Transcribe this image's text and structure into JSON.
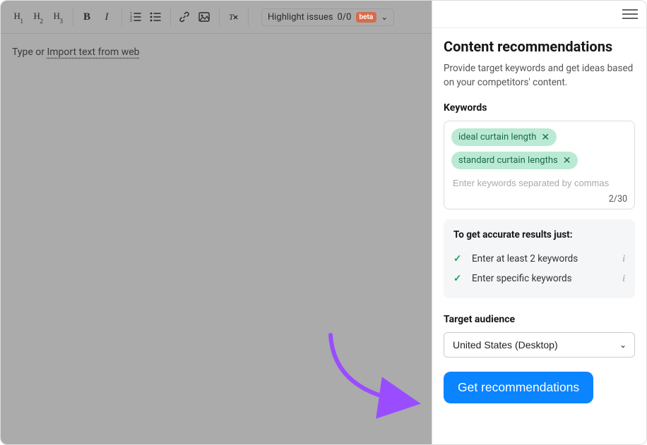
{
  "toolbar": {
    "h1": "H",
    "h1_sub": "1",
    "h2": "H",
    "h2_sub": "2",
    "h3": "H",
    "h3_sub": "3",
    "bold": "B",
    "italic": "I",
    "highlight_label": "Highlight issues",
    "highlight_count": "0/0",
    "beta_badge": "beta"
  },
  "editor": {
    "placeholder_prefix": "Type or ",
    "import_link": "Import text from web"
  },
  "sidebar": {
    "title": "Content recommendations",
    "description": "Provide target keywords and get ideas based on your competitors' content.",
    "keywords_label": "Keywords",
    "keywords": [
      "ideal curtain length",
      "standard curtain lengths"
    ],
    "kw_placeholder": "Enter keywords separated by commas",
    "kw_count": "2/30",
    "tips_title": "To get accurate results just:",
    "tips": [
      "Enter at least 2 keywords",
      "Enter specific keywords"
    ],
    "target_label": "Target audience",
    "target_value": "United States (Desktop)",
    "cta": "Get recommendations"
  }
}
